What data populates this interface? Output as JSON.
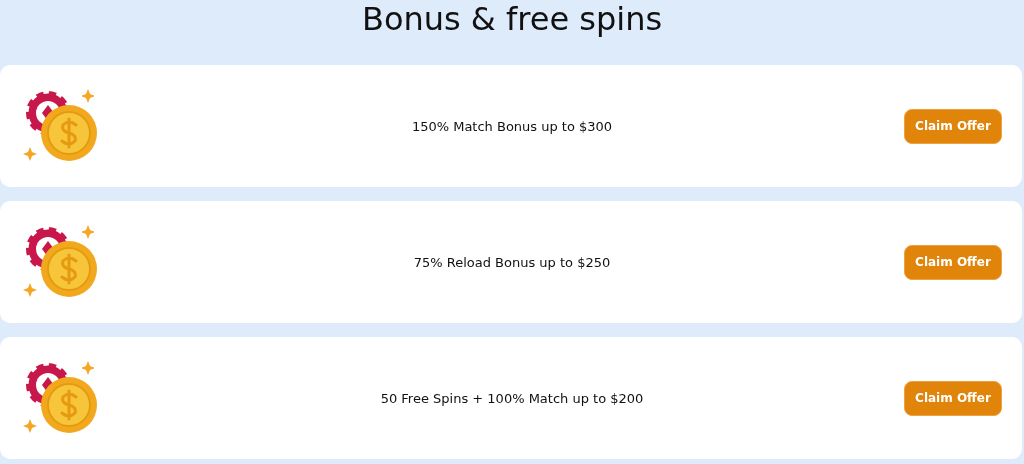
{
  "page_title": "Bonus & free spins",
  "offers": [
    {
      "title": "150% Match Bonus up to $300",
      "button": "Claim Offer"
    },
    {
      "title": "75% Reload Bonus up to $250",
      "button": "Claim Offer"
    },
    {
      "title": "50 Free Spins + 100% Match up to $200",
      "button": "Claim Offer"
    }
  ]
}
